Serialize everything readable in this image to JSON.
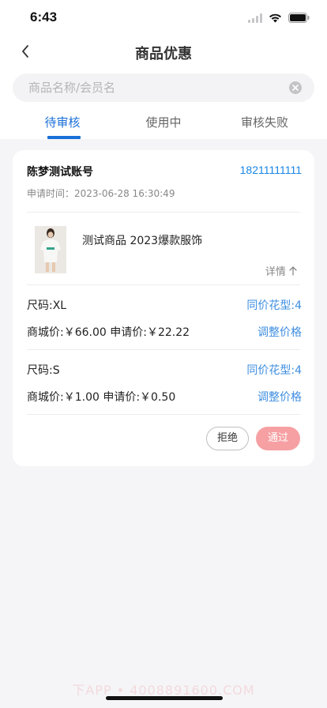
{
  "status_bar": {
    "time": "6:43"
  },
  "header": {
    "title": "商品优惠"
  },
  "search": {
    "placeholder": "商品名称/会员名",
    "value": ""
  },
  "tabs": [
    {
      "label": "待审核",
      "active": true
    },
    {
      "label": "使用中",
      "active": false
    },
    {
      "label": "审核失败",
      "active": false
    }
  ],
  "card": {
    "account_name": "陈梦测试账号",
    "phone": "18211111111",
    "apply_time": "申请时间：2023-06-28 16:30:49",
    "product": {
      "thumbnail_icon": "tshirt-product-photo",
      "name": "测试商品 2023爆款服饰",
      "detail_label": "详情"
    },
    "skus": [
      {
        "size": "尺码:XL",
        "same_price_label": "同价花型:4",
        "prices": "商城价:￥66.00 申请价:￥22.22",
        "adjust_label": "调整价格"
      },
      {
        "size": "尺码:S",
        "same_price_label": "同价花型:4",
        "prices": "商城价:￥1.00 申请价:￥0.50",
        "adjust_label": "调整价格"
      }
    ],
    "reject_label": "拒绝",
    "approve_label": "通过"
  },
  "watermark": "下APP • 4008891600.COM",
  "colors": {
    "accent": "#1a6fd8",
    "link": "#3e8ee0",
    "approve": "#f6a0a3",
    "background": "#f5f5f7"
  }
}
